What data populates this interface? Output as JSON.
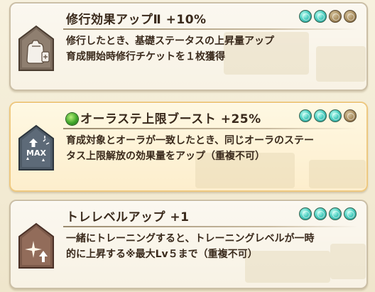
{
  "skills": [
    {
      "title": "修行効果アップⅡ +10%",
      "lines": [
        "修行したとき、基礎ステータスの上昇量アップ",
        "育成開始時修行チケットを１枚獲得"
      ],
      "orbs_filled": 2,
      "orbs_total": 4,
      "highlighted": false,
      "icon": "bag-icon"
    },
    {
      "title": "オーラステ上限ブースト +25%",
      "lines": [
        "育成対象とオーラが一致したとき、同じオーラのステー",
        "タス上限解放の効果量をアップ（重複不可）"
      ],
      "orbs_filled": 3,
      "orbs_total": 4,
      "highlighted": true,
      "icon": "max-boost-icon",
      "icon_label": "MAX"
    },
    {
      "title": "トレレベルアップ +1",
      "lines": [
        "一緒にトレーニングすると、トレーニングレベルが一時",
        "的に上昇する※最大Lv５まで（重複不可）"
      ],
      "orbs_filled": 4,
      "orbs_total": 4,
      "highlighted": false,
      "icon": "training-level-up-icon"
    }
  ],
  "colors": {
    "orb_on": "#4fd0c2",
    "orb_off": "#a68b5c",
    "text": "#3a2a1c",
    "highlight_border": "#eec981"
  }
}
